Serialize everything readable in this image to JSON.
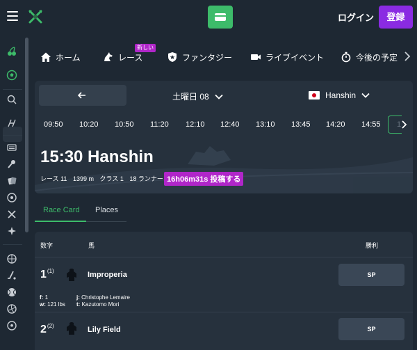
{
  "header": {
    "login_label": "ログイン",
    "register_label": "登録",
    "accent_green": "#3dbb6a",
    "accent_purple": "#8a2be2"
  },
  "nav": {
    "items": [
      {
        "label": "ホーム",
        "icon": "home-icon"
      },
      {
        "label": "レース",
        "icon": "horse-icon",
        "badge": "新しい"
      },
      {
        "label": "ファンタジー",
        "icon": "shield-icon"
      },
      {
        "label": "ライブイベント",
        "icon": "video-icon"
      },
      {
        "label": "今後の予定",
        "icon": "stopwatch-icon"
      }
    ]
  },
  "race_header": {
    "date_label": "土曜日 08",
    "venue_label": "Hanshin",
    "times": [
      "09:50",
      "10:20",
      "10:50",
      "11:20",
      "12:10",
      "12:40",
      "13:10",
      "13:45",
      "14:20",
      "14:55"
    ],
    "time_partial": "1",
    "title": "15:30 Hanshin",
    "meta": {
      "race_label": "レース",
      "race_value": "11",
      "distance": "1399 m",
      "class_label": "クラス",
      "class_value": "1",
      "runners_value": "18",
      "runners_label": "ランナー"
    },
    "countdown": "16h06m31s 投稿する"
  },
  "tabs": [
    {
      "label": "Race Card",
      "active": true
    },
    {
      "label": "Places",
      "active": false
    }
  ],
  "race_card": {
    "columns": {
      "number": "数字",
      "horse": "馬",
      "win": "勝利"
    },
    "runners": [
      {
        "number": "1",
        "draw": "(1)",
        "horse": "Improperia",
        "odds": "SP",
        "form_label": "f:",
        "form": "1",
        "weight_label": "w:",
        "weight": "121 lbs",
        "jockey_label": "j:",
        "jockey": "Christophe Lemaire",
        "trainer_label": "t:",
        "trainer": "Kazutomo Mori"
      },
      {
        "number": "2",
        "draw": "(2)",
        "horse": "Lily Field",
        "odds": "SP"
      }
    ]
  }
}
